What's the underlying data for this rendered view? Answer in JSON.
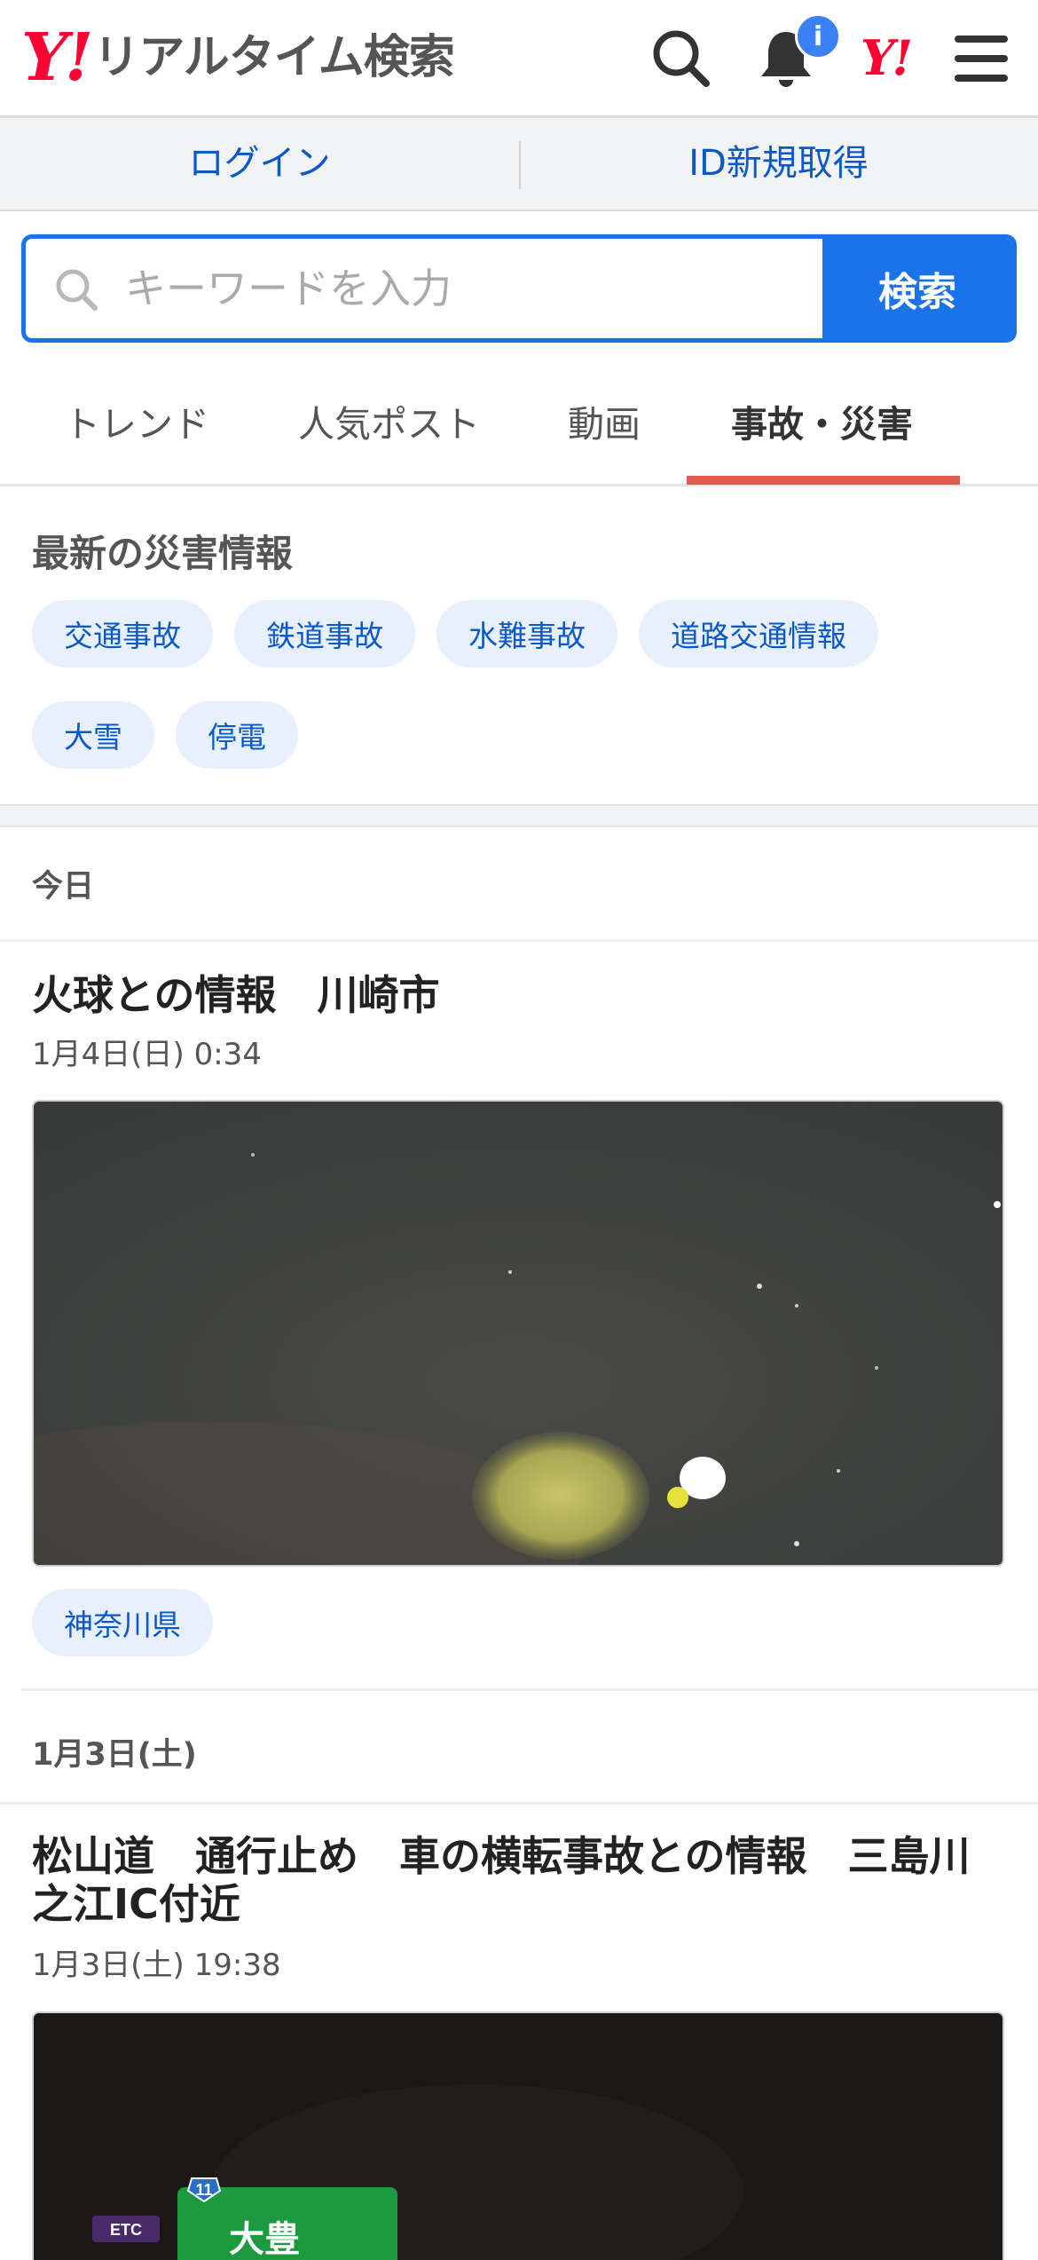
{
  "header": {
    "logo_mark": "Y!",
    "logo_text": "リアルタイム検索",
    "notification_badge": "i",
    "yj_mark": "Y!"
  },
  "account": {
    "login_label": "ログイン",
    "signup_label": "ID新規取得"
  },
  "search": {
    "placeholder": "キーワードを入力",
    "button_label": "検索"
  },
  "tabs": [
    {
      "label": "トレンド"
    },
    {
      "label": "人気ポスト"
    },
    {
      "label": "動画"
    },
    {
      "label": "事故・災害",
      "active": true
    }
  ],
  "disaster": {
    "title": "最新の災害情報",
    "chips": [
      "交通事故",
      "鉄道事故",
      "水難事故",
      "道路交通情報",
      "大雪",
      "停電"
    ]
  },
  "feed": {
    "groups": [
      {
        "date_label": "今日",
        "posts": [
          {
            "title": "火球との情報　川崎市",
            "time": "1月4日(日) 0:34",
            "tags": [
              "神奈川県"
            ]
          }
        ]
      },
      {
        "date_label": "1月3日(土)",
        "posts": [
          {
            "title": "松山道　通行止め　車の横転事故との情報　三島川之江IC付近",
            "time": "1月3日(土) 19:38",
            "sign_route": "11",
            "sign_badge": "ETC",
            "sign_text": "大豊"
          }
        ]
      }
    ]
  },
  "colors": {
    "brand_red": "#ff0033",
    "link_blue": "#0b59c7",
    "search_blue": "#1a73e8",
    "tab_underline": "#e35a4f",
    "chip_bg": "#e7f0fc"
  }
}
